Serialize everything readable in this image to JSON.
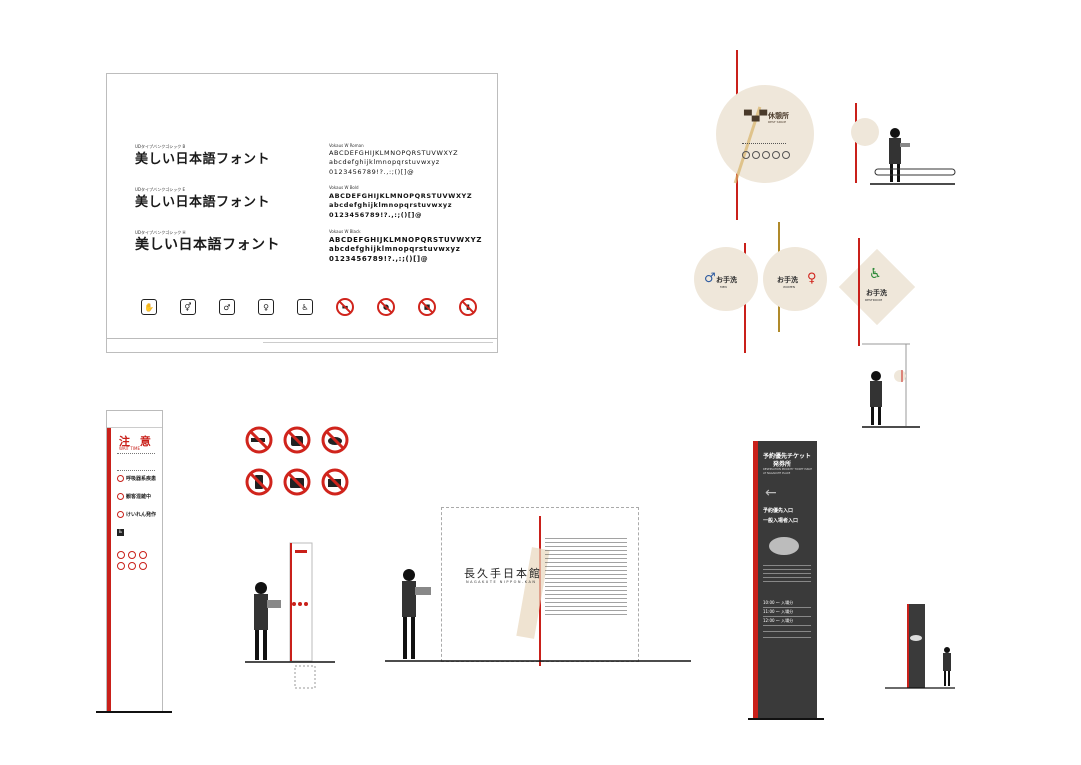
{
  "specimen": {
    "rows": [
      {
        "jp_label": "UDタイプバンクゴシック B",
        "jp_sample": "美しい日本語フォント",
        "latin_name": "Vokaus W Roman",
        "latin_upper": "ABCDEFGHIJKLMNOPQRSTUVWXYZ",
        "latin_lower": "abcdefghijklmnopqrstuvwxyz",
        "digits": "0123456789!?.,:;()[]@"
      },
      {
        "jp_label": "UDタイプバンクゴシック E",
        "jp_sample": "美しい日本語フォント",
        "latin_name": "Vokaus W Bold",
        "latin_upper": "ABCDEFGHIJKLMNOPQRSTUVWXYZ",
        "latin_lower": "abcdefghijklmnopqrstuvwxyz",
        "digits": "0123456789!?.,:;()[]@"
      },
      {
        "jp_label": "UDタイプバンクゴシック H",
        "jp_sample": "美しい日本語フォント",
        "latin_name": "Vokaus W Black",
        "latin_upper": "ABCDEFGHIJKLMNOPQRSTUVWXYZ",
        "latin_lower": "abcdefghijklmnopqrstuvwxyz",
        "digits": "0123456789!?.,:;()[]@"
      }
    ],
    "icons": [
      "hand-stop-icon",
      "restroom-icon",
      "men-icon",
      "women-icon",
      "wheelchair-icon",
      "no-smoking-icon",
      "no-food-icon",
      "no-photo-icon",
      "no-phone-icon"
    ]
  },
  "rest_sign": {
    "title": "休憩所",
    "subtitle": "REST SPACE"
  },
  "restrooms": {
    "men": {
      "label": "お手洗",
      "sub": "MEN"
    },
    "women": {
      "label": "お手洗",
      "sub": "WOMEN"
    },
    "accessible": {
      "label": "お手洗",
      "sub": "RESTROOM"
    }
  },
  "caution_sign": {
    "title": "注 意",
    "subtitle": "WAIT TIME",
    "items": [
      "呼吸器系疾患",
      "観客混雑中",
      "けいれん発作"
    ]
  },
  "wall_sign": {
    "title": "長久手日本館",
    "subtitle": "NAGAKUTE NIPPON-KAN"
  },
  "ticket_sign": {
    "title": "予約優先チケット",
    "title2": "発券所",
    "en": "RESERVATION PRIORITY TICKET ISSUE AT NAGAKUTE PLACE",
    "entry1": "予約優先入口",
    "entry2": "一般入場者入口",
    "times": [
      "10:00 ～ 入場分",
      "11:00 ～ 入場分",
      "12:00 ～ 入場分"
    ]
  },
  "colors": {
    "accent_red": "#c9201a",
    "dark_panel": "#3a3a3a",
    "disc_beige": "#efe7da",
    "men_blue": "#2c5aa0",
    "women_red": "#d0241c",
    "accessible_green": "#2e8b3a"
  }
}
